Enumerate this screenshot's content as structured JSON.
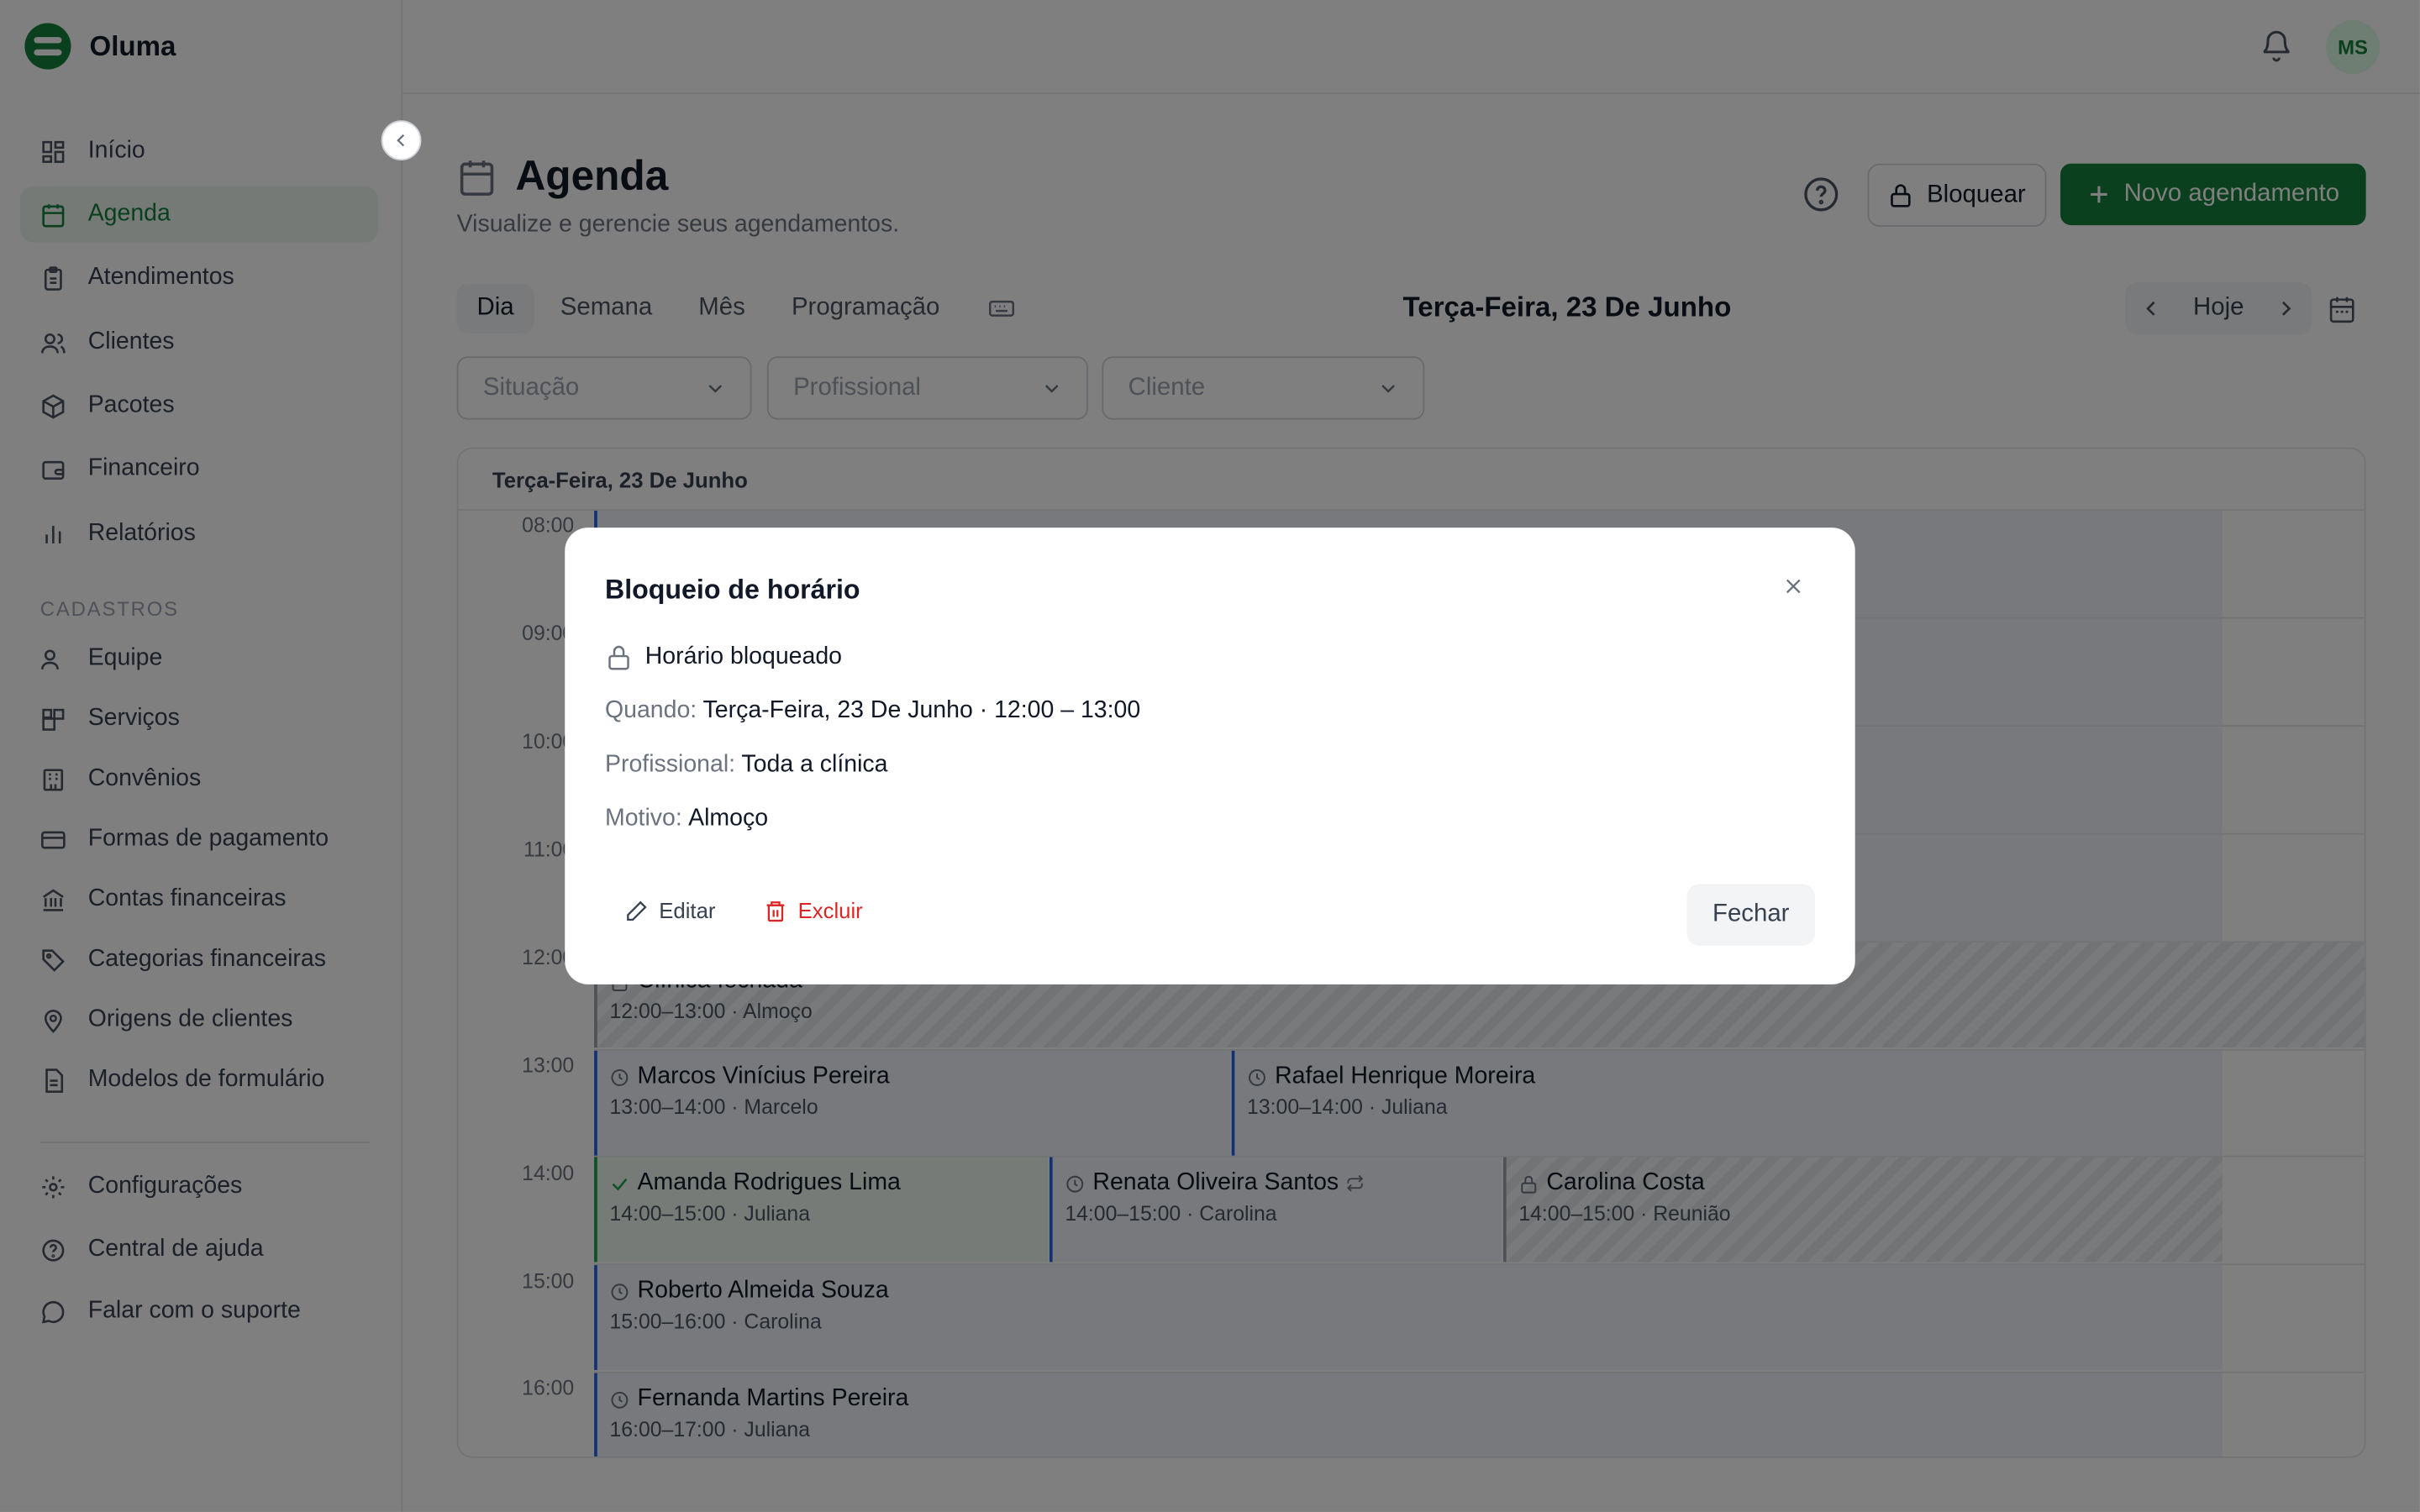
{
  "app": {
    "name": "Oluma"
  },
  "sidebar": {
    "items": [
      {
        "label": "Início",
        "icon": "dashboard-icon"
      },
      {
        "label": "Agenda",
        "icon": "calendar-icon"
      },
      {
        "label": "Atendimentos",
        "icon": "clipboard-icon"
      },
      {
        "label": "Clientes",
        "icon": "users-icon"
      },
      {
        "label": "Pacotes",
        "icon": "package-icon"
      },
      {
        "label": "Financeiro",
        "icon": "wallet-icon"
      },
      {
        "label": "Relatórios",
        "icon": "bar-chart-icon"
      }
    ],
    "section_label": "CADASTROS",
    "registry_items": [
      {
        "label": "Equipe"
      },
      {
        "label": "Serviços"
      },
      {
        "label": "Convênios"
      },
      {
        "label": "Formas de pagamento"
      },
      {
        "label": "Contas financeiras"
      },
      {
        "label": "Categorias financeiras"
      },
      {
        "label": "Origens de clientes"
      },
      {
        "label": "Modelos de formulário"
      }
    ],
    "footer_items": [
      {
        "label": "Configurações"
      },
      {
        "label": "Central de ajuda"
      },
      {
        "label": "Falar com o suporte"
      }
    ]
  },
  "topbar": {
    "avatar_initials": "MS"
  },
  "page": {
    "title": "Agenda",
    "subtitle": "Visualize e gerencie seus agendamentos.",
    "block_button": "Bloquear",
    "new_button": "Novo agendamento"
  },
  "view_tabs": [
    "Dia",
    "Semana",
    "Mês",
    "Programação"
  ],
  "current_date": "Terça-Feira, 23 De Junho",
  "today_label": "Hoje",
  "filters": {
    "status_placeholder": "Situação",
    "professional_placeholder": "Profissional",
    "client_placeholder": "Cliente"
  },
  "calendar": {
    "header": "Terça-Feira, 23 De Junho",
    "hours": [
      "08:00",
      "09:00",
      "10:00",
      "11:00",
      "12:00",
      "13:00",
      "14:00",
      "15:00",
      "16:00"
    ],
    "events": [
      {
        "title": "Clínica fechada",
        "sub": "12:00–13:00 · Almoço",
        "status": "locked"
      },
      {
        "title": "Marcos Vinícius Pereira",
        "sub": "13:00–14:00 · Marcelo",
        "status": "scheduled"
      },
      {
        "title": "Rafael Henrique Moreira",
        "sub": "13:00–14:00 · Juliana",
        "status": "scheduled"
      },
      {
        "title": "Amanda Rodrigues Lima",
        "sub": "14:00–15:00 · Juliana",
        "status": "done"
      },
      {
        "title": "Renata Oliveira Santos",
        "sub": "14:00–15:00 · Carolina",
        "status": "recurring"
      },
      {
        "title": "Carolina Costa",
        "sub": "14:00–15:00 · Reunião",
        "status": "locked"
      },
      {
        "title": "Roberto Almeida Souza",
        "sub": "15:00–16:00 · Carolina",
        "status": "scheduled"
      },
      {
        "title": "Fernanda Martins Pereira",
        "sub": "16:00–17:00 · Juliana",
        "status": "scheduled"
      }
    ]
  },
  "modal": {
    "title": "Bloqueio de horário",
    "status": "Horário bloqueado",
    "when_label": "Quando:",
    "when_value": "Terça-Feira, 23 De Junho · 12:00 – 13:00",
    "professional_label": "Profissional:",
    "professional_value": "Toda a clínica",
    "reason_label": "Motivo:",
    "reason_value": "Almoço",
    "edit_label": "Editar",
    "delete_label": "Excluir",
    "close_label": "Fechar"
  },
  "colors": {
    "brand": "#15803d",
    "danger": "#dc2626",
    "event_accent": "#2563eb"
  }
}
